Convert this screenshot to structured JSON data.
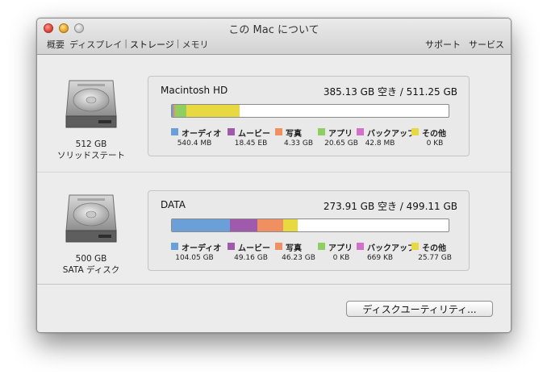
{
  "window": {
    "title": "この Mac について",
    "tabs": [
      "概要",
      "ディスプレイ",
      "ストレージ",
      "メモリ"
    ],
    "right_links": [
      "サポート",
      "サービス"
    ]
  },
  "drives": [
    {
      "size": "512 GB",
      "type": "ソリッドステート",
      "volume": "Macintosh HD",
      "free": "385.13 GB 空き / 511.25 GB",
      "usage_fractions": {
        "other": 0.02,
        "apps": 0.04,
        "movies": 0.0,
        "audio": 0.001,
        "photos": 0.0,
        "backup": 0.0,
        "yellow": 0.19
      },
      "legend": [
        {
          "label": "オーディオ",
          "value": "540.4 MB",
          "color": "#6b9fd8"
        },
        {
          "label": "ムービー",
          "value": "18.45 EB",
          "color": "#a05aab"
        },
        {
          "label": "写真",
          "value": "4.33 GB",
          "color": "#f08f5f"
        },
        {
          "label": "アプリ",
          "value": "20.65 GB",
          "color": "#8fcf62"
        },
        {
          "label": "バックアップ",
          "value": "42.8 MB",
          "color": "#d271c9"
        },
        {
          "label": "その他",
          "value": "0 KB",
          "color": "#e8d940"
        }
      ]
    },
    {
      "size": "500 GB",
      "type": "SATA ディスク",
      "volume": "DATA",
      "free": "273.91 GB 空き / 499.11 GB",
      "legend": [
        {
          "label": "オーディオ",
          "value": "104.05 GB",
          "color": "#6b9fd8"
        },
        {
          "label": "ムービー",
          "value": "49.16 GB",
          "color": "#a05aab"
        },
        {
          "label": "写真",
          "value": "46.23 GB",
          "color": "#f08f5f"
        },
        {
          "label": "アプリ",
          "value": "0 KB",
          "color": "#8fcf62"
        },
        {
          "label": "バックアップ",
          "value": "669 KB",
          "color": "#d271c9"
        },
        {
          "label": "その他",
          "value": "25.77 GB",
          "color": "#e8d940"
        }
      ]
    }
  ],
  "buttons": {
    "disk_utility": "ディスクユーティリティ..."
  }
}
